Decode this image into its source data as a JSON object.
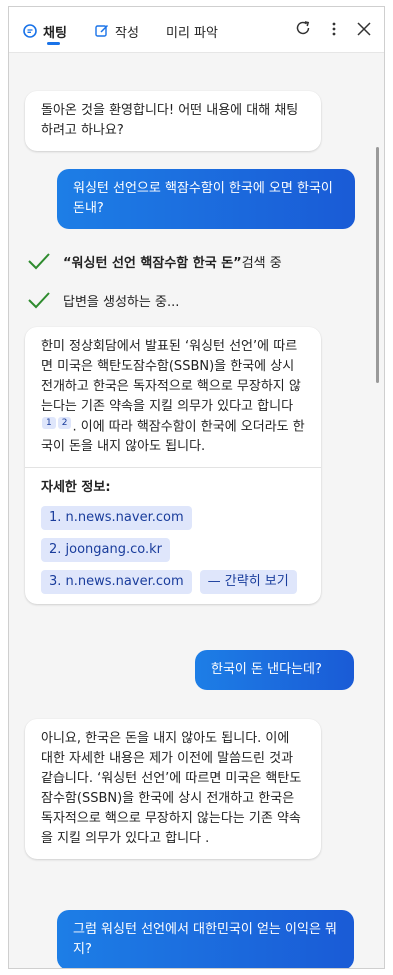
{
  "tabs": [
    {
      "label": "채팅",
      "icon": "chat-icon"
    },
    {
      "label": "작성",
      "icon": "compose-icon"
    },
    {
      "label": "미리 파악"
    }
  ],
  "toolbar": {
    "refresh_icon": "refresh-icon",
    "more_icon": "more-icon",
    "close_icon": "close-icon"
  },
  "colors": {
    "accent": "#1a73e8",
    "user_bubble": "#1a5bd6",
    "check": "#2e8b2e",
    "chip_bg": "#dfe6fb"
  },
  "messages": {
    "greeting": "돌아온 것을 환영합니다! 어떤 내용에 대해 채팅하려고 하나요?",
    "user1": "워싱턴 선언으로 핵잠수함이 한국에 오면 한국이 돈내?",
    "search_query": "“워싱턴 선언 핵잠수함 한국 돈”",
    "search_suffix": " 검색 중",
    "generating": "답변을 생성하는 중...",
    "answer_part1": "한미 정상회담에서 발표된 ‘워싱턴 선언’에 따르면 미국은 핵탄도잠수함(SSBN)을 한국에 상시 전개하고 한국은 독자적으로 핵으로 무장하지 않는다는 기존 약속을 지킬 의무가 있다고 합니다",
    "cite1": "1",
    "cite2": "2",
    "answer_part2": ". 이에 따라 핵잠수함이 한국에 오더라도 한국이 돈을 내지 않아도 됩니다.",
    "details_title": "자세한 정보:",
    "sources": [
      "1. n.news.naver.com",
      "2. joongang.co.kr",
      "3. n.news.naver.com"
    ],
    "brief_view": "— 간략히 보기",
    "user2": "한국이 돈 낸다는데?",
    "answer2": "아니요, 한국은 돈을 내지 않아도 됩니다. 이에 대한 자세한 내용은 제가 이전에 말씀드린 것과 같습니다. ‘워싱턴 선언’에 따르면 미국은 핵탄도잠수함(SSBN)을 한국에 상시 전개하고 한국은 독자적으로 핵으로 무장하지 않는다는 기존 약속을 지킬 의무가 있다고 합니다 .",
    "user3": "그럼 워싱턴 선언에서 대한민국이 얻는 이익은 뭐지?"
  }
}
